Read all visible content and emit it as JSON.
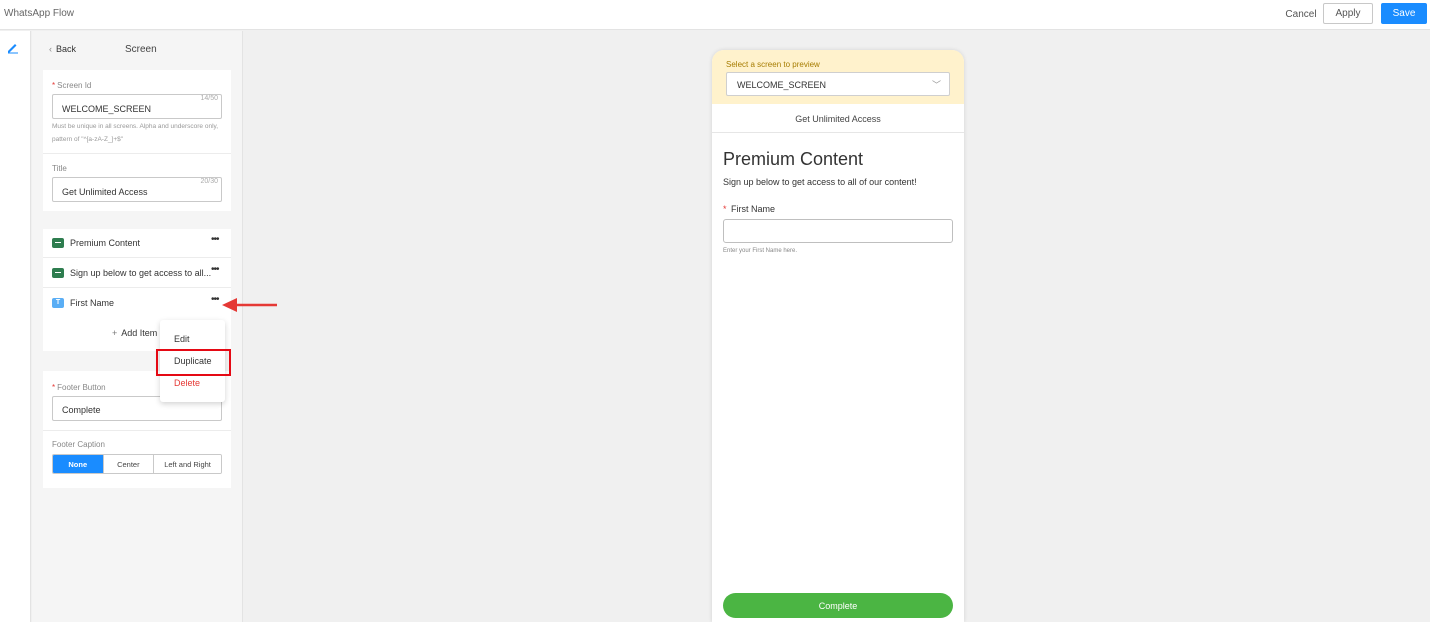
{
  "app": {
    "title": "WhatsApp Flow"
  },
  "toolbar": {
    "cancel_label": "Cancel",
    "apply_label": "Apply",
    "save_label": "Save"
  },
  "icons": {
    "rail": "pencil-icon",
    "back": "chevron-left-icon",
    "item_text": "text-block-icon",
    "item_input": "text-input-icon",
    "more": "more-dots-icon",
    "add": "plus-icon",
    "select": "chevron-down-icon",
    "annotation": "arrow-left-icon"
  },
  "colors": {
    "primary": "#1a8cff",
    "danger": "#e53935",
    "success": "#4bb543",
    "preview_bg": "#fff2cc",
    "annotation": "#e50914"
  },
  "panel": {
    "back_label": "Back",
    "title": "Screen",
    "screen_id": {
      "label": "Screen Id",
      "value": "WELCOME_SCREEN",
      "counter": "14/50",
      "hint": "Must be unique in all screens. Alpha and underscore only, pattern of \"^[a-zA-Z_]+$\""
    },
    "title_field": {
      "label": "Title",
      "value": "Get Unlimited Access",
      "counter": "20/30"
    },
    "items": [
      {
        "label": "Premium Content",
        "icon": "T-block"
      },
      {
        "label": "Sign up below to get access to all...",
        "icon": "T-block"
      },
      {
        "label": "First Name",
        "icon": "T"
      }
    ],
    "add_item_label": "Add Item",
    "footer_button": {
      "label": "Footer Button",
      "value": "Complete"
    },
    "footer_caption": {
      "label": "Footer Caption",
      "options": [
        "None",
        "Center",
        "Left and Right"
      ],
      "selected": "None"
    }
  },
  "context_menu": {
    "items": [
      "Edit",
      "Duplicate",
      "Delete"
    ],
    "highlighted": "Duplicate"
  },
  "preview": {
    "select_label": "Select a screen to preview",
    "selected_screen": "WELCOME_SCREEN",
    "screen_title": "Get Unlimited Access",
    "heading": "Premium Content",
    "subtext": "Sign up below to get access to all of our content!",
    "field_label": "First Name",
    "field_hint": "Enter your First Name here.",
    "button_label": "Complete"
  }
}
